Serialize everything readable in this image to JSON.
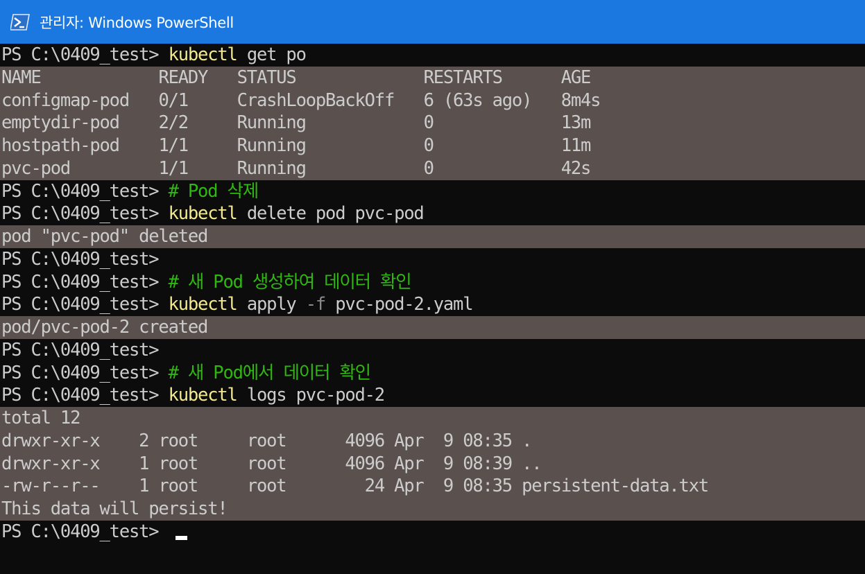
{
  "window": {
    "title": "관리자: Windows PowerShell",
    "icon": "powershell-icon",
    "titlebar_color": "#1a78e0"
  },
  "prompt": "PS C:\\0409_test>",
  "colors": {
    "background": "#0c0c0c",
    "output_highlight": "#5a514e",
    "command": "#f2e88e",
    "comment": "#2fb80f",
    "text": "#cccccc"
  },
  "console": {
    "cmd1": {
      "name": "kubectl",
      "args": " get po"
    },
    "pods_table": {
      "headers": [
        "NAME",
        "READY",
        "STATUS",
        "RESTARTS",
        "AGE"
      ],
      "rows": [
        [
          "configmap-pod",
          "0/1",
          "CrashLoopBackOff",
          "6 (63s ago)",
          "8m4s"
        ],
        [
          "emptydir-pod",
          "2/2",
          "Running",
          "0",
          "13m"
        ],
        [
          "hostpath-pod",
          "1/1",
          "Running",
          "0",
          "11m"
        ],
        [
          "pvc-pod",
          "1/1",
          "Running",
          "0",
          "42s"
        ]
      ]
    },
    "comment1": "# Pod 삭제",
    "cmd2": {
      "name": "kubectl",
      "args": " delete pod pvc-pod"
    },
    "out2": "pod \"pvc-pod\" deleted",
    "comment2": "# 새 Pod 생성하여 데이터 확인",
    "cmd3": {
      "name": "kubectl",
      "args_a": " apply ",
      "flag": "-f",
      "args_b": " pvc-pod-2.yaml"
    },
    "out3": "pod/pvc-pod-2 created",
    "comment3": "# 새 Pod에서 데이터 확인",
    "cmd4": {
      "name": "kubectl",
      "args": " logs pvc-pod-2"
    },
    "logs": {
      "total": "total 12",
      "rows": [
        [
          "drwxr-xr-x",
          "2",
          "root",
          "root",
          "4096",
          "Apr",
          "9",
          "08:35",
          "."
        ],
        [
          "drwxr-xr-x",
          "1",
          "root",
          "root",
          "4096",
          "Apr",
          "9",
          "08:39",
          ".."
        ],
        [
          "-rw-r--r--",
          "1",
          "root",
          "root",
          "24",
          "Apr",
          "9",
          "08:35",
          "persistent-data.txt"
        ]
      ],
      "message": "This data will persist!"
    }
  }
}
